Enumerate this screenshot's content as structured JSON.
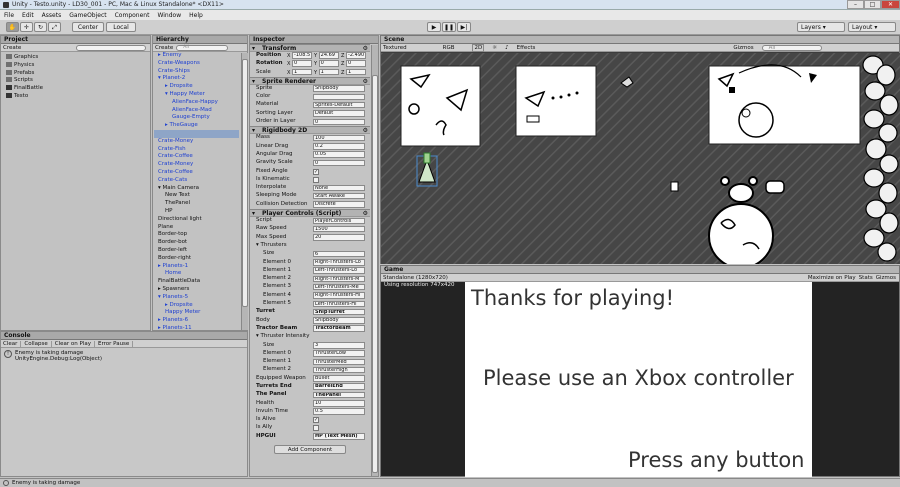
{
  "window": {
    "title": "Unity - Testo.unity - LD30_001 - PC, Mac & Linux Standalone* <DX11>"
  },
  "menu": [
    "File",
    "Edit",
    "Assets",
    "GameObject",
    "Component",
    "Window",
    "Help"
  ],
  "toolbar": {
    "center": "Center",
    "local": "Local",
    "layers": "Layers",
    "layout": "Layout"
  },
  "project": {
    "tab": "Project",
    "create": "Create",
    "items": [
      "Graphics",
      "Physics",
      "Prefabs",
      "Scripts",
      "FinalBattle",
      "Testo"
    ]
  },
  "hierarchy": {
    "tab": "Hierarchy",
    "create": "Create",
    "search": "All",
    "items": [
      {
        "t": "▸ Enemy",
        "c": "blue",
        "i": 0
      },
      {
        "t": "Crate-Weapons",
        "c": "blue",
        "i": 0
      },
      {
        "t": "Crate-Ships",
        "c": "blue",
        "i": 0
      },
      {
        "t": "▾ Planet-2",
        "c": "blue",
        "i": 0
      },
      {
        "t": "▸ Dropsite",
        "c": "blue",
        "i": 1
      },
      {
        "t": "▾ Happy Meter",
        "c": "blue",
        "i": 1
      },
      {
        "t": "AlienFace-Happy",
        "c": "blue",
        "i": 2
      },
      {
        "t": "AlienFace-Mad",
        "c": "blue",
        "i": 2
      },
      {
        "t": "Gauge-Empty",
        "c": "blue",
        "i": 2
      },
      {
        "t": "▸ TheGauge",
        "c": "blue",
        "i": 1
      },
      {
        "t": "",
        "c": "sel",
        "i": 0
      },
      {
        "t": "Crate-Money",
        "c": "blue",
        "i": 0
      },
      {
        "t": "Crate-Fish",
        "c": "blue",
        "i": 0
      },
      {
        "t": "Crate-Coffee",
        "c": "blue",
        "i": 0
      },
      {
        "t": "Crate-Money",
        "c": "blue",
        "i": 0
      },
      {
        "t": "Crate-Coffee",
        "c": "blue",
        "i": 0
      },
      {
        "t": "Crate-Cats",
        "c": "blue",
        "i": 0
      },
      {
        "t": "▾ Main Camera",
        "c": "",
        "i": 0
      },
      {
        "t": "New Text",
        "c": "",
        "i": 1
      },
      {
        "t": "ThePanel",
        "c": "",
        "i": 1
      },
      {
        "t": "HP",
        "c": "",
        "i": 1
      },
      {
        "t": "Directional light",
        "c": "",
        "i": 0
      },
      {
        "t": "Plane",
        "c": "",
        "i": 0
      },
      {
        "t": "Border-top",
        "c": "",
        "i": 0
      },
      {
        "t": "Border-bot",
        "c": "",
        "i": 0
      },
      {
        "t": "Border-left",
        "c": "",
        "i": 0
      },
      {
        "t": "Border-right",
        "c": "",
        "i": 0
      },
      {
        "t": "▸ Planets-1",
        "c": "blue",
        "i": 0
      },
      {
        "t": "Home",
        "c": "blue",
        "i": 1
      },
      {
        "t": "FinalBattleData",
        "c": "",
        "i": 0
      },
      {
        "t": "▸ Spawners",
        "c": "",
        "i": 0
      },
      {
        "t": "▾ Planets-5",
        "c": "blue",
        "i": 0
      },
      {
        "t": "▸ Dropsite",
        "c": "blue",
        "i": 1
      },
      {
        "t": "Happy Meter",
        "c": "blue",
        "i": 1
      },
      {
        "t": "▸ Planets-6",
        "c": "blue",
        "i": 0
      },
      {
        "t": "▸ Planets-11",
        "c": "blue",
        "i": 0
      },
      {
        "t": "▸ Planets-8",
        "c": "blue",
        "i": 0
      }
    ]
  },
  "console": {
    "tab": "Console",
    "buttons": [
      "Clear",
      "Collapse",
      "Clear on Play",
      "Error Pause"
    ],
    "line1": "Enemy is taking damage",
    "line2": "UnityEngine.Debug:Log(Object)"
  },
  "statusbar": "Enemy is taking damage",
  "inspector": {
    "tab": "Inspector",
    "transform": {
      "title": "Transform",
      "rows": [
        {
          "label": "Position",
          "x": "-108.5",
          "y": "24.69",
          "z": "-2.490"
        },
        {
          "label": "Rotation",
          "x": "0",
          "y": "0",
          "z": "0"
        },
        {
          "label": "Scale",
          "x": "1",
          "y": "1",
          "z": "1"
        }
      ]
    },
    "sprite": {
      "title": "Sprite Renderer",
      "rows": [
        {
          "label": "Sprite",
          "value": "ShipBody"
        },
        {
          "label": "Color",
          "value": ""
        },
        {
          "label": "Material",
          "value": "Sprites-Default"
        },
        {
          "label": "Sorting Layer",
          "value": "Default"
        },
        {
          "label": "Order in Layer",
          "value": "0"
        }
      ]
    },
    "rigidbody": {
      "title": "Rigidbody 2D",
      "rows": [
        {
          "label": "Mass",
          "value": "100"
        },
        {
          "label": "Linear Drag",
          "value": "0.2"
        },
        {
          "label": "Angular Drag",
          "value": "0.05"
        },
        {
          "label": "Gravity Scale",
          "value": "0"
        },
        {
          "label": "Fixed Angle",
          "value": "✓"
        },
        {
          "label": "Is Kinematic",
          "value": ""
        },
        {
          "label": "Interpolate",
          "value": "None"
        },
        {
          "label": "Sleeping Mode",
          "value": "Start Awake"
        },
        {
          "label": "Collision Detection",
          "value": "Discrete"
        }
      ]
    },
    "player": {
      "title": "Player Controls (Script)",
      "rows": [
        {
          "label": "Script",
          "value": "PlayerControls",
          "b": false
        },
        {
          "label": "Raw Speed",
          "value": "1500",
          "b": false
        },
        {
          "label": "Max Speed",
          "value": "20",
          "b": false
        },
        {
          "label": "▾ Thrusters",
          "value": "",
          "b": false
        },
        {
          "label": "Size",
          "value": "6",
          "b": false,
          "ind": true
        },
        {
          "label": "Element 0",
          "value": "Right-Thrusters-Lo",
          "b": false,
          "ind": true
        },
        {
          "label": "Element 1",
          "value": "Left-Thrusters-Lo",
          "b": false,
          "ind": true
        },
        {
          "label": "Element 2",
          "value": "Right-Thrusters-M",
          "b": false,
          "ind": true
        },
        {
          "label": "Element 3",
          "value": "Left-Thrusters-Me",
          "b": false,
          "ind": true
        },
        {
          "label": "Element 4",
          "value": "Right-Thrusters-Hi",
          "b": false,
          "ind": true
        },
        {
          "label": "Element 5",
          "value": "Left-Thrusters-Hi",
          "b": false,
          "ind": true
        },
        {
          "label": "Turret",
          "value": "ShipTurret",
          "b": true
        },
        {
          "label": "Body",
          "value": "ShipBody",
          "b": false
        },
        {
          "label": "Tractor Beam",
          "value": "TractorBeam",
          "b": true
        },
        {
          "label": "▾ Thruster Intensity",
          "value": "",
          "b": false
        },
        {
          "label": "Size",
          "value": "3",
          "b": false,
          "ind": true
        },
        {
          "label": "Element 0",
          "value": "ThrusterLow",
          "b": false,
          "ind": true
        },
        {
          "label": "Element 1",
          "value": "ThrusterMed",
          "b": false,
          "ind": true
        },
        {
          "label": "Element 2",
          "value": "ThrusterHigh",
          "b": false,
          "ind": true
        },
        {
          "label": "Equipped Weapon",
          "value": "Bullet",
          "b": false
        },
        {
          "label": "Turrets End",
          "value": "BarrelEnd",
          "b": true
        },
        {
          "label": "The Panel",
          "value": "ThePanel",
          "b": true
        },
        {
          "label": "Health",
          "value": "10",
          "b": false
        },
        {
          "label": "Invuln Time",
          "value": "0.5",
          "b": false
        },
        {
          "label": "Is Alive",
          "value": "✓",
          "b": false
        },
        {
          "label": "Is Ally",
          "value": "",
          "b": false
        },
        {
          "label": "HPGUI",
          "value": "HP (Text Mesh)",
          "b": true
        }
      ]
    },
    "add_component": "Add Component"
  },
  "scene": {
    "tab": "Scene",
    "shading": "Textured",
    "mode": "RGB",
    "twod": "2D",
    "effects": "Effects",
    "gizmos": "Gizmos",
    "search": "All"
  },
  "game": {
    "tab": "Game",
    "aspect": "Standalone (1280x720)",
    "maximize": "Maximize on Play",
    "stats": "Stats",
    "gizmos": "Gizmos",
    "resolution": "Using resolution 747x420",
    "text1": "Thanks for playing!",
    "text2": "Please use an Xbox controller",
    "text3": "Press any button"
  }
}
